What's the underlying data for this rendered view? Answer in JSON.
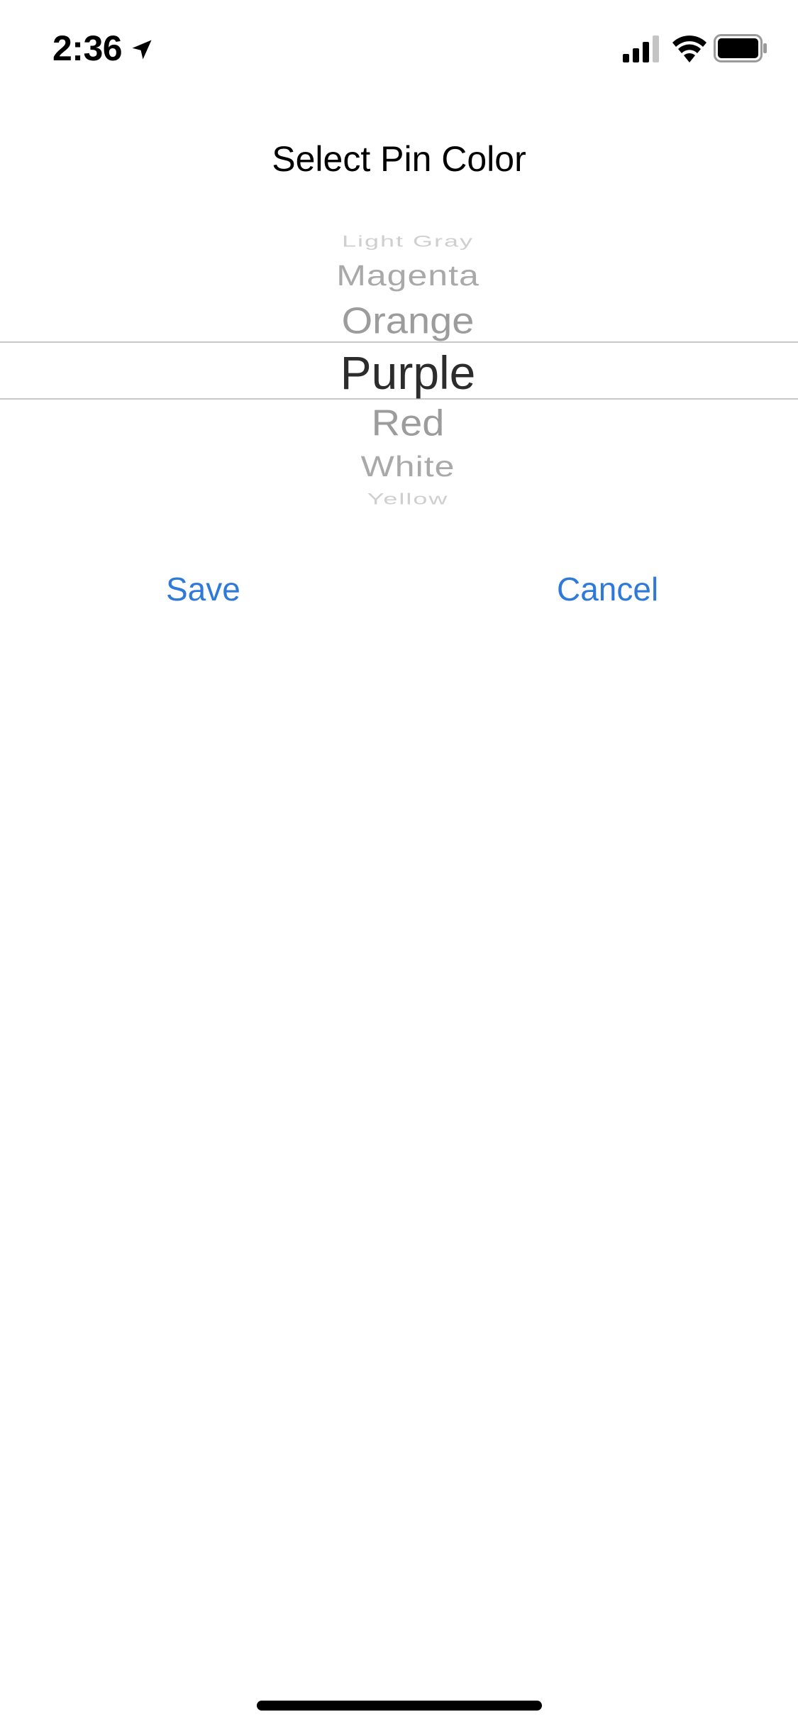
{
  "status_bar": {
    "time": "2:36",
    "icons": [
      "location-arrow-icon",
      "cellular-signal-icon",
      "wifi-icon",
      "battery-icon"
    ]
  },
  "title": "Select Pin Color",
  "picker": {
    "items": [
      "Light Gray",
      "Magenta",
      "Orange",
      "Purple",
      "Red",
      "White",
      "Yellow"
    ],
    "selected": "Purple"
  },
  "buttons": {
    "save_label": "Save",
    "cancel_label": "Cancel"
  },
  "colors": {
    "accent": "#2f7ad8",
    "selected_text": "#2c2c2c",
    "unselected_text": "#9c9c9c",
    "divider": "#c8c8c8"
  }
}
